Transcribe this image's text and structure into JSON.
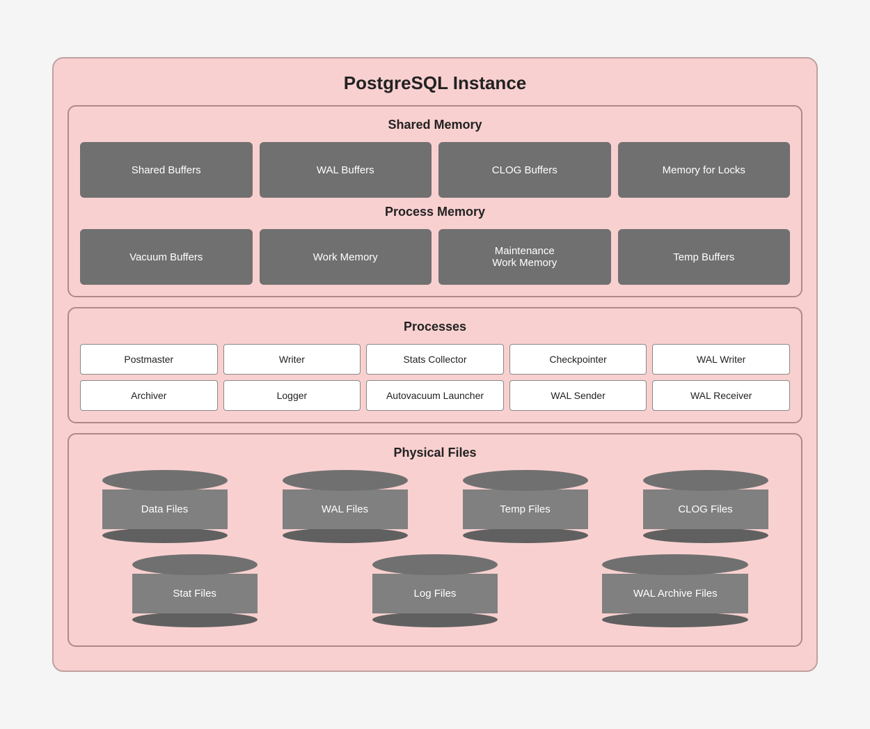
{
  "title": "PostgreSQL Instance",
  "sharedMemory": {
    "label": "Shared Memory",
    "items": [
      "Shared Buffers",
      "WAL Buffers",
      "CLOG Buffers",
      "Memory for Locks"
    ]
  },
  "processMemory": {
    "label": "Process Memory",
    "items": [
      "Vacuum Buffers",
      "Work Memory",
      "Maintenance\nWork Memory",
      "Temp Buffers"
    ]
  },
  "processes": {
    "label": "Processes",
    "row1": [
      "Postmaster",
      "Writer",
      "Stats Collector",
      "Checkpointer",
      "WAL Writer"
    ],
    "row2": [
      "Archiver",
      "Logger",
      "Autovacuum Launcher",
      "WAL Sender",
      "WAL Receiver"
    ]
  },
  "physicalFiles": {
    "label": "Physical Files",
    "row1": [
      "Data Files",
      "WAL Files",
      "Temp Files",
      "CLOG Files"
    ],
    "row2": [
      "Stat Files",
      "Log Files",
      "WAL Archive Files"
    ]
  }
}
